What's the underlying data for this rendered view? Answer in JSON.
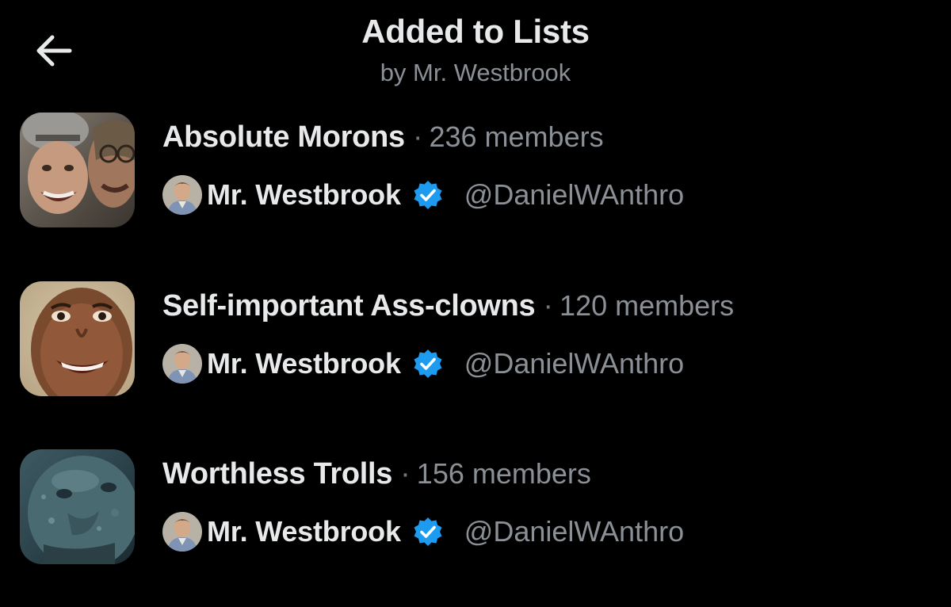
{
  "header": {
    "title": "Added to Lists",
    "subtitle": "by Mr. Westbrook",
    "back_icon": "arrow-left-icon"
  },
  "lists": [
    {
      "name": "Absolute Morons",
      "separator": "·",
      "members": "236 members",
      "owner_name": "Mr. Westbrook",
      "owner_handle": "@DanielWAnthro",
      "thumbnail": "two-people-selfie-photo"
    },
    {
      "name": "Self-important Ass-clowns",
      "separator": "·",
      "members": "120 members",
      "owner_name": "Mr. Westbrook",
      "owner_handle": "@DanielWAnthro",
      "thumbnail": "smiling-woman-photo"
    },
    {
      "name": "Worthless Trolls",
      "separator": "·",
      "members": "156 members",
      "owner_name": "Mr. Westbrook",
      "owner_handle": "@DanielWAnthro",
      "thumbnail": "stone-troll-face-photo"
    }
  ],
  "colors": {
    "background": "#000000",
    "primary_text": "#e7e9ea",
    "secondary_text": "#8b9096",
    "verified_blue": "#1d9bf0"
  }
}
